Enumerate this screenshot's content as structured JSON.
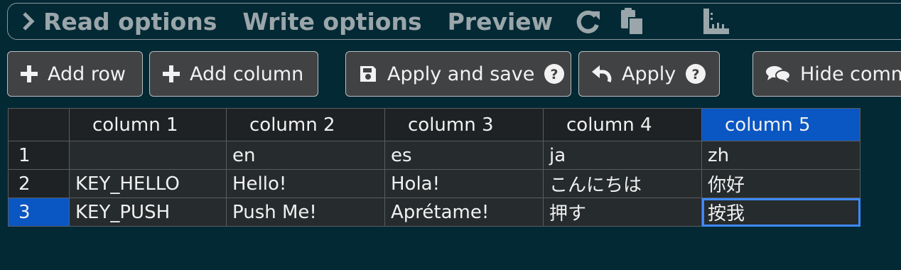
{
  "toolbar": {
    "read_options": "Read options",
    "write_options": "Write options",
    "preview": "Preview",
    "icons": [
      "chevron-right-icon",
      "refresh-icon",
      "paste-icon",
      "ruler-icon"
    ]
  },
  "buttons": {
    "add_row": "Add row",
    "add_column": "Add column",
    "apply_and_save": "Apply and save",
    "apply": "Apply",
    "hide_comments": "Hide comm"
  },
  "table": {
    "columns": [
      "column 1",
      "column 2",
      "column 3",
      "column 4",
      "column 5"
    ],
    "rows": [
      {
        "num": "1",
        "cells": [
          "",
          "en",
          "es",
          "ja",
          "zh"
        ]
      },
      {
        "num": "2",
        "cells": [
          "KEY_HELLO",
          "Hello!",
          "Hola!",
          "こんにちは",
          "你好"
        ]
      },
      {
        "num": "3",
        "cells": [
          "KEY_PUSH",
          "Push Me!",
          "Aprétame!",
          "押す",
          "按我"
        ]
      }
    ],
    "selected_column": "column 5",
    "selected_row": "3",
    "active_cell": "按我"
  },
  "colors": {
    "background": "#032935",
    "selection": "#0a56c2",
    "active_border": "#3d8aff"
  }
}
